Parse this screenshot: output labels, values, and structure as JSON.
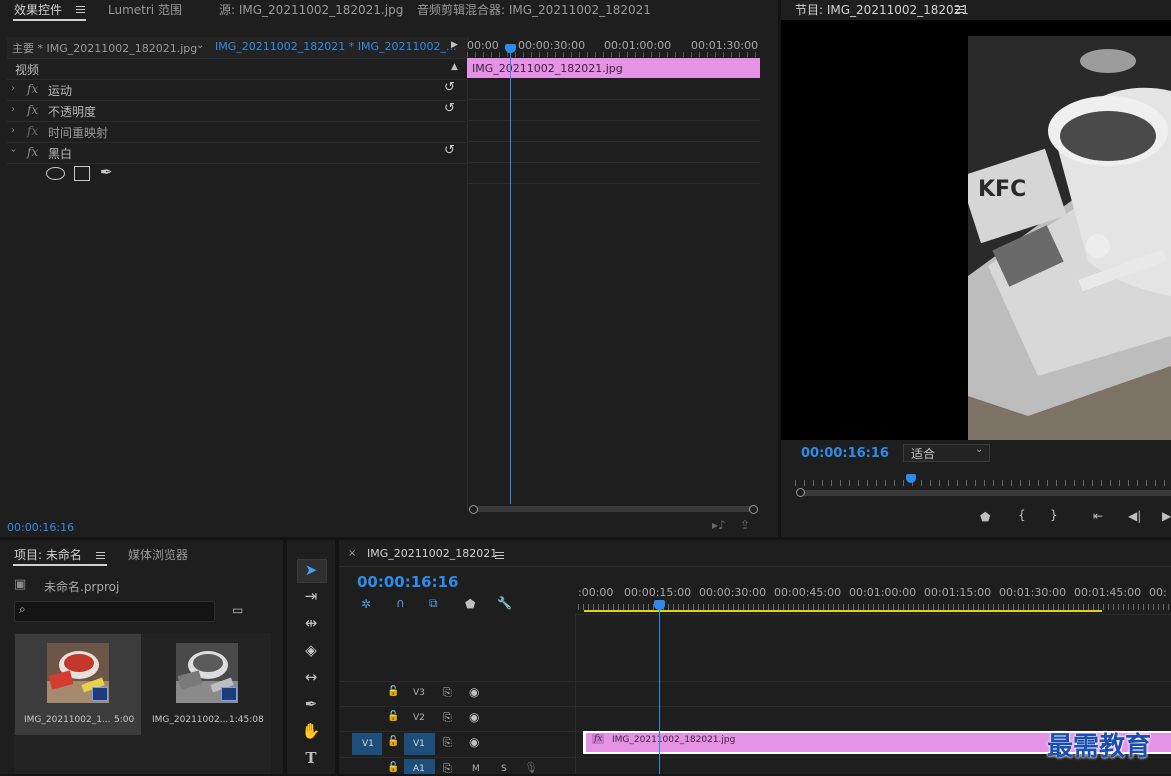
{
  "top_tabs": {
    "effect_controls": "效果控件",
    "lumetri": "Lumetri 范围",
    "source": "源: IMG_20211002_182021.jpg",
    "audio_mixer": "音频剪辑混合器: IMG_20211002_182021"
  },
  "effect_controls": {
    "master_label": "主要 * IMG_20211002_182021.jpg",
    "sequence_label": "IMG_20211002_182021 * IMG_20211002_...",
    "section_video": "视频",
    "effects": [
      "运动",
      "不透明度",
      "时间重映射",
      "黑白"
    ],
    "ruler": [
      "00:00",
      "00:00:30:00",
      "00:01:00:00",
      "00:01:30:00"
    ],
    "clip_name": "IMG_20211002_182021.jpg",
    "timecode": "00:00:16:16"
  },
  "program": {
    "title": "节目: IMG_20211002_182021",
    "timecode": "00:00:16:16",
    "fit_option": "适合"
  },
  "project": {
    "tab_project": "项目: 未命名",
    "tab_media_browser": "媒体浏览器",
    "project_file": "未命名.prproj",
    "search_placeholder": "",
    "items": [
      {
        "name": "IMG_20211002_1...",
        "duration": "5:00"
      },
      {
        "name": "IMG_20211002...",
        "duration": "1:45:08"
      }
    ]
  },
  "timeline": {
    "close_glyph": "×",
    "sequence_name": "IMG_20211002_182021",
    "timecode": "00:00:16:16",
    "ruler": [
      ":00:00",
      "00:00:15:00",
      "00:00:30:00",
      "00:00:45:00",
      "00:01:00:00",
      "00:01:15:00",
      "00:01:30:00",
      "00:01:45:00",
      "00:"
    ],
    "tracks": [
      "V3",
      "V2",
      "V1",
      "A1"
    ],
    "source_patch": "V1",
    "track_m": "M",
    "track_s": "S",
    "clip_name": "IMG_20211002_182021.jpg",
    "fx_badge": "fx"
  },
  "watermark": "最需教育",
  "colors": {
    "accent_blue": "#2d8ceb",
    "clip_pink": "#e592e4",
    "work_area_yellow": "#e1d21e"
  }
}
